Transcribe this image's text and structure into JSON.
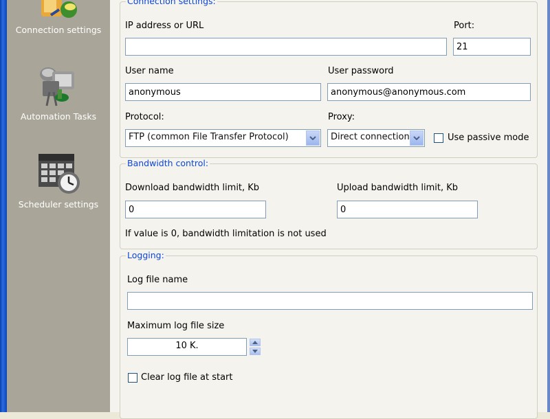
{
  "sidebar": {
    "items": [
      {
        "label": "Connection settings",
        "icon": "connection-icon"
      },
      {
        "label": "Automation Tasks",
        "icon": "automation-icon"
      },
      {
        "label": "Scheduler settings",
        "icon": "scheduler-icon"
      }
    ]
  },
  "connection": {
    "legend": "Connection settings:",
    "ip_label": "IP address or URL",
    "ip_value": "",
    "port_label": "Port:",
    "port_value": "21",
    "user_label": "User name",
    "user_value": "anonymous",
    "password_label": "User password",
    "password_value": "anonymous@anonymous.com",
    "protocol_label": "Protocol:",
    "protocol_value": "FTP (common File Transfer Protocol)",
    "proxy_label": "Proxy:",
    "proxy_value": "Direct connection",
    "passive_label": "Use passive mode",
    "passive_checked": false
  },
  "bandwidth": {
    "legend": "Bandwidth control:",
    "download_label": "Download bandwidth limit, Kb",
    "download_value": "0",
    "upload_label": "Upload bandwidth limit, Kb",
    "upload_value": "0",
    "note": "If value is 0, bandwidth limitation is not used"
  },
  "logging": {
    "legend": "Logging:",
    "logfile_label": "Log file name",
    "logfile_value": "",
    "maxsize_label": "Maximum log file size",
    "maxsize_value": "10 K.",
    "clear_label": "Clear log file at start",
    "clear_checked": false
  },
  "colors": {
    "legend": "#0D46D7",
    "sidebar": "#A9A699",
    "input_border": "#7F9DB9"
  }
}
